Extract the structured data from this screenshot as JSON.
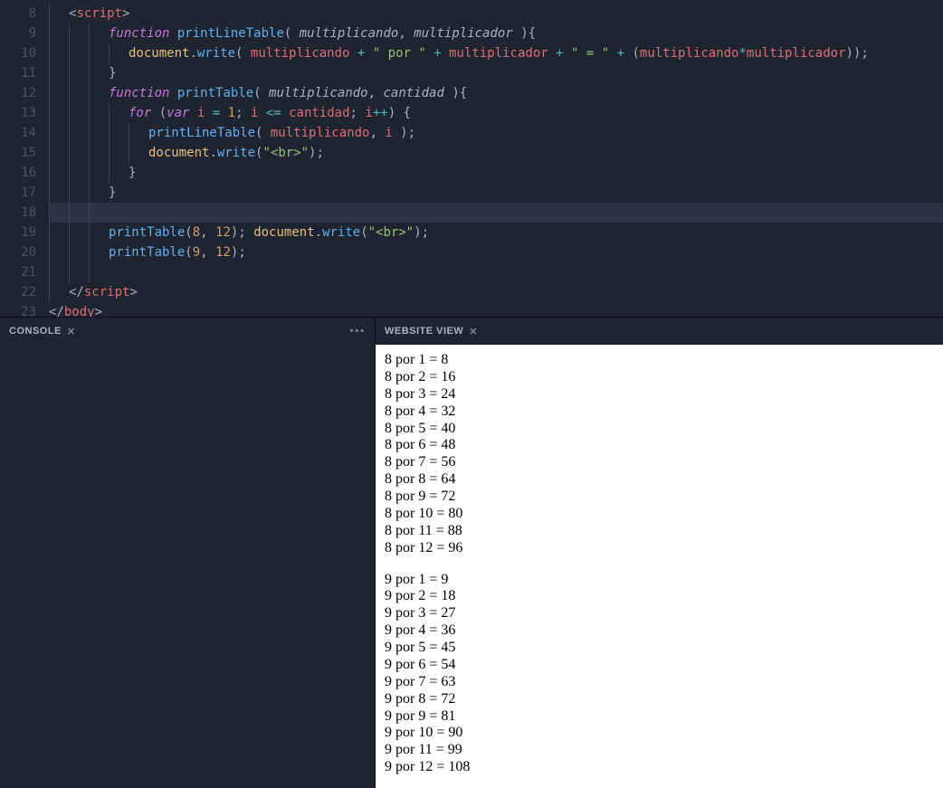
{
  "editor": {
    "first_line": 8,
    "highlight_line": 18,
    "lines": [
      {
        "indent": 1,
        "tokens": [
          [
            "pun",
            "<"
          ],
          [
            "tag",
            "script"
          ],
          [
            "pun",
            ">"
          ]
        ]
      },
      {
        "indent": 3,
        "tokens": [
          [
            "key",
            "function"
          ],
          [
            "pun",
            " "
          ],
          [
            "fn",
            "printLineTable"
          ],
          [
            "pun",
            "( "
          ],
          [
            "par",
            "multiplicando"
          ],
          [
            "pun",
            ", "
          ],
          [
            "par",
            "multiplicador"
          ],
          [
            "pun",
            " ){"
          ]
        ]
      },
      {
        "indent": 4,
        "tokens": [
          [
            "obj",
            "document"
          ],
          [
            "pun",
            "."
          ],
          [
            "fn",
            "write"
          ],
          [
            "pun",
            "( "
          ],
          [
            "id",
            "multiplicando"
          ],
          [
            "pun",
            " "
          ],
          [
            "op",
            "+"
          ],
          [
            "pun",
            " "
          ],
          [
            "str",
            "\" por \""
          ],
          [
            "pun",
            " "
          ],
          [
            "op",
            "+"
          ],
          [
            "pun",
            " "
          ],
          [
            "id",
            "multiplicador"
          ],
          [
            "pun",
            " "
          ],
          [
            "op",
            "+"
          ],
          [
            "pun",
            " "
          ],
          [
            "str",
            "\" = \""
          ],
          [
            "pun",
            " "
          ],
          [
            "op",
            "+"
          ],
          [
            "pun",
            " ("
          ],
          [
            "id",
            "multiplicando"
          ],
          [
            "op",
            "*"
          ],
          [
            "id",
            "multiplicador"
          ],
          [
            "pun",
            "));"
          ]
        ]
      },
      {
        "indent": 3,
        "tokens": [
          [
            "pun",
            "}"
          ]
        ]
      },
      {
        "indent": 3,
        "tokens": [
          [
            "key",
            "function"
          ],
          [
            "pun",
            " "
          ],
          [
            "fn",
            "printTable"
          ],
          [
            "pun",
            "( "
          ],
          [
            "par",
            "multiplicando"
          ],
          [
            "pun",
            ", "
          ],
          [
            "par",
            "cantidad"
          ],
          [
            "pun",
            " ){"
          ]
        ]
      },
      {
        "indent": 4,
        "tokens": [
          [
            "key",
            "for"
          ],
          [
            "pun",
            " ("
          ],
          [
            "key",
            "var"
          ],
          [
            "pun",
            " "
          ],
          [
            "id",
            "i"
          ],
          [
            "pun",
            " "
          ],
          [
            "op",
            "="
          ],
          [
            "pun",
            " "
          ],
          [
            "num",
            "1"
          ],
          [
            "pun",
            "; "
          ],
          [
            "id",
            "i"
          ],
          [
            "pun",
            " "
          ],
          [
            "op",
            "<="
          ],
          [
            "pun",
            " "
          ],
          [
            "id",
            "cantidad"
          ],
          [
            "pun",
            "; "
          ],
          [
            "id",
            "i"
          ],
          [
            "op",
            "++"
          ],
          [
            "pun",
            ") {"
          ]
        ]
      },
      {
        "indent": 5,
        "tokens": [
          [
            "fn",
            "printLineTable"
          ],
          [
            "pun",
            "( "
          ],
          [
            "id",
            "multiplicando"
          ],
          [
            "pun",
            ", "
          ],
          [
            "id",
            "i"
          ],
          [
            "pun",
            " );"
          ]
        ]
      },
      {
        "indent": 5,
        "tokens": [
          [
            "obj",
            "document"
          ],
          [
            "pun",
            "."
          ],
          [
            "fn",
            "write"
          ],
          [
            "pun",
            "("
          ],
          [
            "str",
            "\"<br>\""
          ],
          [
            "pun",
            ");"
          ]
        ]
      },
      {
        "indent": 4,
        "tokens": [
          [
            "pun",
            "}"
          ]
        ]
      },
      {
        "indent": 3,
        "tokens": [
          [
            "pun",
            "}"
          ]
        ]
      },
      {
        "indent": 3,
        "tokens": []
      },
      {
        "indent": 3,
        "tokens": [
          [
            "fn",
            "printTable"
          ],
          [
            "pun",
            "("
          ],
          [
            "num",
            "8"
          ],
          [
            "pun",
            ", "
          ],
          [
            "num",
            "12"
          ],
          [
            "pun",
            "); "
          ],
          [
            "obj",
            "document"
          ],
          [
            "pun",
            "."
          ],
          [
            "fn",
            "write"
          ],
          [
            "pun",
            "("
          ],
          [
            "str",
            "\"<br>\""
          ],
          [
            "pun",
            ");"
          ]
        ]
      },
      {
        "indent": 3,
        "tokens": [
          [
            "fn",
            "printTable"
          ],
          [
            "pun",
            "("
          ],
          [
            "num",
            "9"
          ],
          [
            "pun",
            ", "
          ],
          [
            "num",
            "12"
          ],
          [
            "pun",
            ");"
          ]
        ]
      },
      {
        "indent": 3,
        "tokens": []
      },
      {
        "indent": 1,
        "tokens": [
          [
            "pun",
            "</"
          ],
          [
            "tag",
            "script"
          ],
          [
            "pun",
            ">"
          ]
        ]
      },
      {
        "indent": 0,
        "tokens": [
          [
            "pun",
            "</"
          ],
          [
            "tag",
            "body"
          ],
          [
            "pun",
            ">"
          ]
        ]
      }
    ]
  },
  "console": {
    "title": "CONSOLE"
  },
  "preview": {
    "title": "WEBSITE VIEW",
    "lines1": [
      "8 por 1 = 8",
      "8 por 2 = 16",
      "8 por 3 = 24",
      "8 por 4 = 32",
      "8 por 5 = 40",
      "8 por 6 = 48",
      "8 por 7 = 56",
      "8 por 8 = 64",
      "8 por 9 = 72",
      "8 por 10 = 80",
      "8 por 11 = 88",
      "8 por 12 = 96"
    ],
    "lines2": [
      "9 por 1 = 9",
      "9 por 2 = 18",
      "9 por 3 = 27",
      "9 por 4 = 36",
      "9 por 5 = 45",
      "9 por 6 = 54",
      "9 por 7 = 63",
      "9 por 8 = 72",
      "9 por 9 = 81",
      "9 por 10 = 90",
      "9 por 11 = 99",
      "9 por 12 = 108"
    ]
  },
  "colors": {
    "bg": "#1e2430",
    "hl": "#2b3445",
    "gutter": "#4b5363"
  }
}
